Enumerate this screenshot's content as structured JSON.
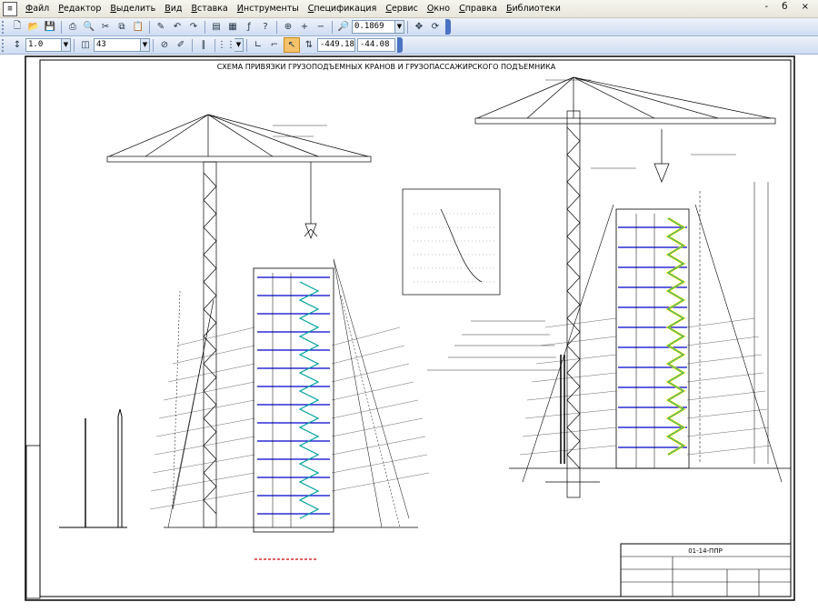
{
  "menu": {
    "app_icon": "app-menu-icon",
    "items": [
      "Файл",
      "Редактор",
      "Выделить",
      "Вид",
      "Вставка",
      "Инструменты",
      "Спецификация",
      "Сервис",
      "Окно",
      "Справка",
      "Библиотеки"
    ],
    "window_controls": "- б ×"
  },
  "toolbar1": {
    "zoom_value": "0.1869",
    "icons": [
      "new-doc-icon",
      "open-icon",
      "save-icon",
      "print-icon",
      "preview-icon",
      "cut-icon",
      "copy-icon",
      "paste-icon",
      "properties-icon",
      "undo-icon",
      "redo-icon",
      "manager-icon",
      "tree-icon",
      "variables-icon",
      "help-icon",
      "zoom-window-icon",
      "zoom-in-icon",
      "zoom-out-icon",
      "zoom-scale-icon",
      "pan-icon",
      "refresh-icon"
    ]
  },
  "toolbar2": {
    "step_value": "1.0",
    "layer_value": "43",
    "coord_x": "-449.18",
    "coord_y": "-44.08",
    "icons": [
      "step-cursor-icon",
      "layer-icon",
      "snap-icon",
      "style-icon",
      "angle-icon",
      "grid-icon",
      "ortho-icon",
      "local-cs-icon"
    ]
  },
  "drawing": {
    "title": "СХЕМА ПРИВЯЗКИ ГРУЗОПОДЪЕМНЫХ КРАНОВ И ГРУЗОПАССАЖИРСКОГО ПОДЪЕМНИКА",
    "stamp_code": "01-14-ППР",
    "colors": {
      "frame": "#000000",
      "floor": "#0000cc",
      "stair": "#00a0a0",
      "hatch": "#e8e000",
      "redmark": "#cc0000"
    }
  }
}
